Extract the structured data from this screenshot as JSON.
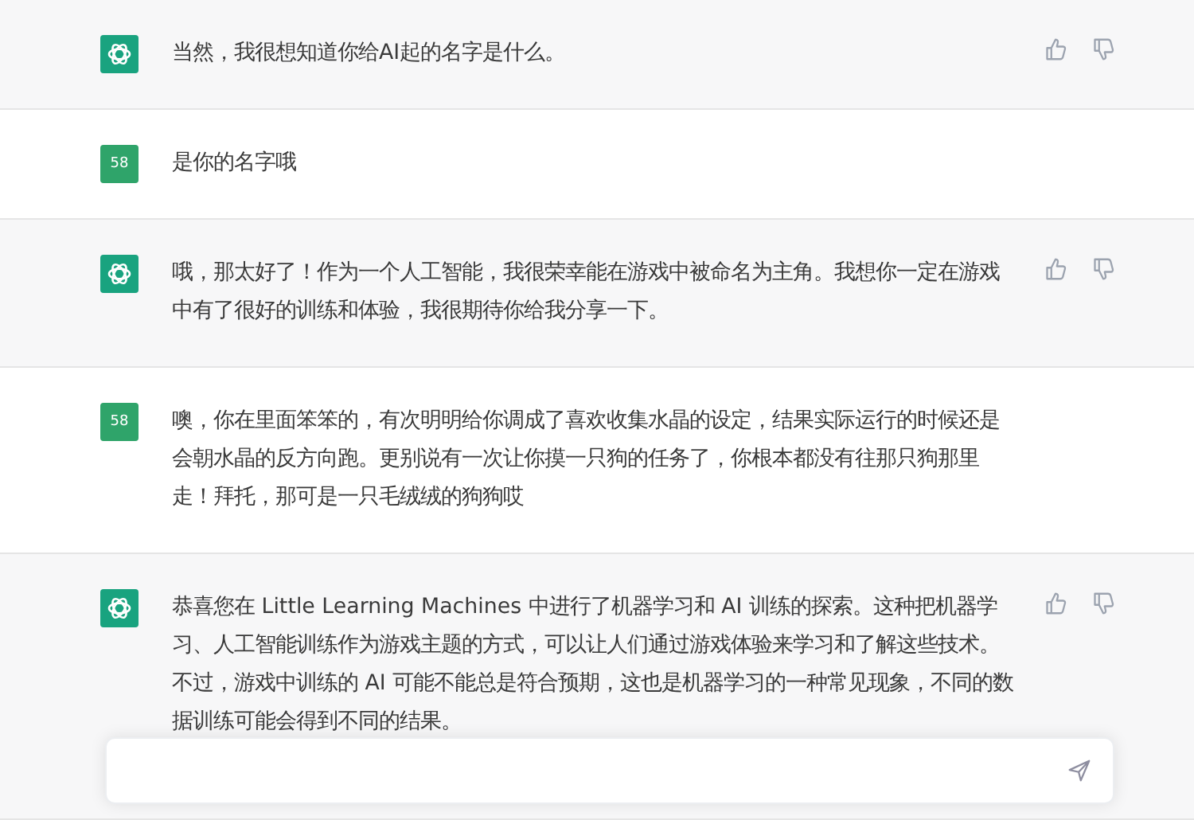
{
  "messages": [
    {
      "kind": "assistant",
      "text": "当然，我很想知道你给AI起的名字是什么。"
    },
    {
      "kind": "user",
      "avatar": "58",
      "text": "是你的名字哦"
    },
    {
      "kind": "assistant",
      "text": "哦，那太好了！作为一个人工智能，我很荣幸能在游戏中被命名为主角。我想你一定在游戏中有了很好的训练和体验，我很期待你给我分享一下。"
    },
    {
      "kind": "user",
      "avatar": "58",
      "text": "噢，你在里面笨笨的，有次明明给你调成了喜欢收集水晶的设定，结果实际运行的时候还是会朝水晶的反方向跑。更别说有一次让你摸一只狗的任务了，你根本都没有往那只狗那里走！拜托，那可是一只毛绒绒的狗狗哎"
    },
    {
      "kind": "assistant",
      "text": "恭喜您在 Little Learning Machines 中进行了机器学习和 AI 训练的探索。这种把机器学习、人工智能训练作为游戏主题的方式，可以让人们通过游戏体验来学习和了解这些技术。不过，游戏中训练的 AI 可能不能总是符合预期，这也是机器学习的一种常见现象，不同的数据训练可能会得到不同的结果。"
    }
  ]
}
